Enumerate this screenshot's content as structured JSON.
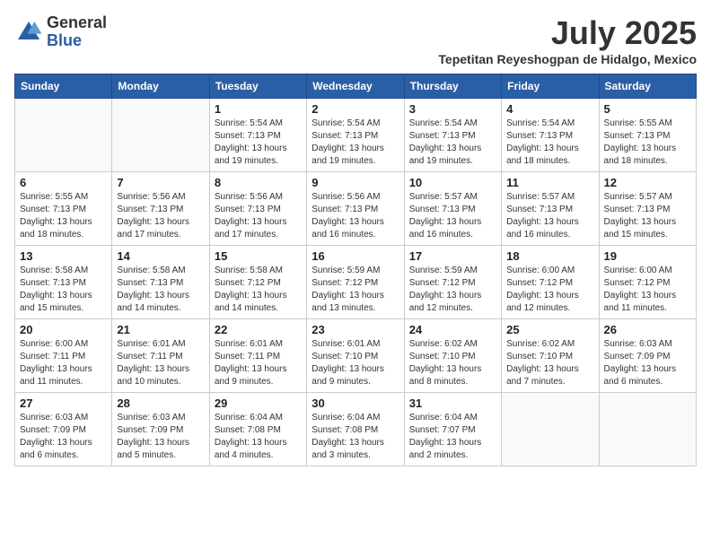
{
  "logo": {
    "general": "General",
    "blue": "Blue"
  },
  "header": {
    "month": "July 2025",
    "location": "Tepetitan Reyeshogpan de Hidalgo, Mexico"
  },
  "days_of_week": [
    "Sunday",
    "Monday",
    "Tuesday",
    "Wednesday",
    "Thursday",
    "Friday",
    "Saturday"
  ],
  "weeks": [
    [
      {
        "day": "",
        "info": ""
      },
      {
        "day": "",
        "info": ""
      },
      {
        "day": "1",
        "info": "Sunrise: 5:54 AM\nSunset: 7:13 PM\nDaylight: 13 hours and 19 minutes."
      },
      {
        "day": "2",
        "info": "Sunrise: 5:54 AM\nSunset: 7:13 PM\nDaylight: 13 hours and 19 minutes."
      },
      {
        "day": "3",
        "info": "Sunrise: 5:54 AM\nSunset: 7:13 PM\nDaylight: 13 hours and 19 minutes."
      },
      {
        "day": "4",
        "info": "Sunrise: 5:54 AM\nSunset: 7:13 PM\nDaylight: 13 hours and 18 minutes."
      },
      {
        "day": "5",
        "info": "Sunrise: 5:55 AM\nSunset: 7:13 PM\nDaylight: 13 hours and 18 minutes."
      }
    ],
    [
      {
        "day": "6",
        "info": "Sunrise: 5:55 AM\nSunset: 7:13 PM\nDaylight: 13 hours and 18 minutes."
      },
      {
        "day": "7",
        "info": "Sunrise: 5:56 AM\nSunset: 7:13 PM\nDaylight: 13 hours and 17 minutes."
      },
      {
        "day": "8",
        "info": "Sunrise: 5:56 AM\nSunset: 7:13 PM\nDaylight: 13 hours and 17 minutes."
      },
      {
        "day": "9",
        "info": "Sunrise: 5:56 AM\nSunset: 7:13 PM\nDaylight: 13 hours and 16 minutes."
      },
      {
        "day": "10",
        "info": "Sunrise: 5:57 AM\nSunset: 7:13 PM\nDaylight: 13 hours and 16 minutes."
      },
      {
        "day": "11",
        "info": "Sunrise: 5:57 AM\nSunset: 7:13 PM\nDaylight: 13 hours and 16 minutes."
      },
      {
        "day": "12",
        "info": "Sunrise: 5:57 AM\nSunset: 7:13 PM\nDaylight: 13 hours and 15 minutes."
      }
    ],
    [
      {
        "day": "13",
        "info": "Sunrise: 5:58 AM\nSunset: 7:13 PM\nDaylight: 13 hours and 15 minutes."
      },
      {
        "day": "14",
        "info": "Sunrise: 5:58 AM\nSunset: 7:13 PM\nDaylight: 13 hours and 14 minutes."
      },
      {
        "day": "15",
        "info": "Sunrise: 5:58 AM\nSunset: 7:12 PM\nDaylight: 13 hours and 14 minutes."
      },
      {
        "day": "16",
        "info": "Sunrise: 5:59 AM\nSunset: 7:12 PM\nDaylight: 13 hours and 13 minutes."
      },
      {
        "day": "17",
        "info": "Sunrise: 5:59 AM\nSunset: 7:12 PM\nDaylight: 13 hours and 12 minutes."
      },
      {
        "day": "18",
        "info": "Sunrise: 6:00 AM\nSunset: 7:12 PM\nDaylight: 13 hours and 12 minutes."
      },
      {
        "day": "19",
        "info": "Sunrise: 6:00 AM\nSunset: 7:12 PM\nDaylight: 13 hours and 11 minutes."
      }
    ],
    [
      {
        "day": "20",
        "info": "Sunrise: 6:00 AM\nSunset: 7:11 PM\nDaylight: 13 hours and 11 minutes."
      },
      {
        "day": "21",
        "info": "Sunrise: 6:01 AM\nSunset: 7:11 PM\nDaylight: 13 hours and 10 minutes."
      },
      {
        "day": "22",
        "info": "Sunrise: 6:01 AM\nSunset: 7:11 PM\nDaylight: 13 hours and 9 minutes."
      },
      {
        "day": "23",
        "info": "Sunrise: 6:01 AM\nSunset: 7:10 PM\nDaylight: 13 hours and 9 minutes."
      },
      {
        "day": "24",
        "info": "Sunrise: 6:02 AM\nSunset: 7:10 PM\nDaylight: 13 hours and 8 minutes."
      },
      {
        "day": "25",
        "info": "Sunrise: 6:02 AM\nSunset: 7:10 PM\nDaylight: 13 hours and 7 minutes."
      },
      {
        "day": "26",
        "info": "Sunrise: 6:03 AM\nSunset: 7:09 PM\nDaylight: 13 hours and 6 minutes."
      }
    ],
    [
      {
        "day": "27",
        "info": "Sunrise: 6:03 AM\nSunset: 7:09 PM\nDaylight: 13 hours and 6 minutes."
      },
      {
        "day": "28",
        "info": "Sunrise: 6:03 AM\nSunset: 7:09 PM\nDaylight: 13 hours and 5 minutes."
      },
      {
        "day": "29",
        "info": "Sunrise: 6:04 AM\nSunset: 7:08 PM\nDaylight: 13 hours and 4 minutes."
      },
      {
        "day": "30",
        "info": "Sunrise: 6:04 AM\nSunset: 7:08 PM\nDaylight: 13 hours and 3 minutes."
      },
      {
        "day": "31",
        "info": "Sunrise: 6:04 AM\nSunset: 7:07 PM\nDaylight: 13 hours and 2 minutes."
      },
      {
        "day": "",
        "info": ""
      },
      {
        "day": "",
        "info": ""
      }
    ]
  ]
}
